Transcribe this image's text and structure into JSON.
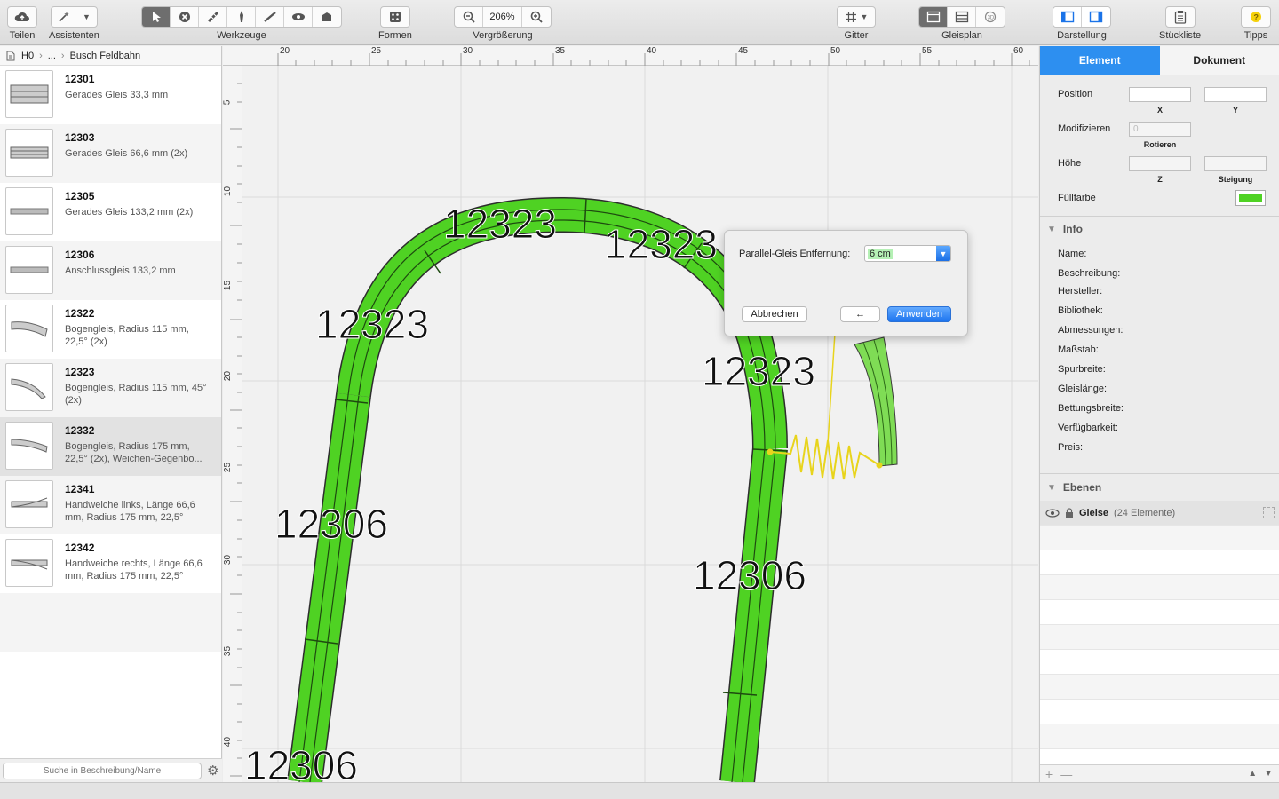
{
  "toolbar": {
    "share_label": "Teilen",
    "assistants_label": "Assistenten",
    "tools_label": "Werkzeuge",
    "shapes_label": "Formen",
    "zoom_label": "Vergrößerung",
    "zoom_value": "206%",
    "grid_label": "Gitter",
    "trackplan_label": "Gleisplan",
    "view_label": "Darstellung",
    "bom_label": "Stückliste",
    "tips_label": "Tipps"
  },
  "breadcrumb": [
    "H0",
    "...",
    "Busch Feldbahn"
  ],
  "library": {
    "items": [
      {
        "number": "12301",
        "desc": "Gerades Gleis 33,3 mm"
      },
      {
        "number": "12303",
        "desc": "Gerades Gleis 66,6 mm (2x)"
      },
      {
        "number": "12305",
        "desc": "Gerades Gleis 133,2 mm (2x)"
      },
      {
        "number": "12306",
        "desc": "Anschlussgleis 133,2 mm"
      },
      {
        "number": "12322",
        "desc": "Bogengleis, Radius 115 mm, 22,5° (2x)"
      },
      {
        "number": "12323",
        "desc": "Bogengleis, Radius 115 mm, 45° (2x)"
      },
      {
        "number": "12332",
        "desc": "Bogengleis, Radius 175 mm, 22,5° (2x), Weichen-Gegenbo..."
      },
      {
        "number": "12341",
        "desc": "Handweiche links, Länge 66,6 mm, Radius 175 mm, 22,5°"
      },
      {
        "number": "12342",
        "desc": "Handweiche rechts, Länge 66,6 mm, Radius 175 mm, 22,5°"
      }
    ],
    "search_placeholder": "Suche in Beschreibung/Name"
  },
  "rulers": {
    "h": [
      "20",
      "25",
      "30",
      "35",
      "40",
      "45",
      "50",
      "55",
      "60"
    ],
    "v": [
      "5",
      "10",
      "15",
      "20",
      "25",
      "30",
      "35",
      "40"
    ]
  },
  "plan_labels": [
    "12323",
    "12323",
    "12323",
    "12323",
    "12306",
    "12306",
    "12306"
  ],
  "track_color": "#4fd223",
  "popover": {
    "label": "Parallel-Gleis Entfernung:",
    "value": "6 cm",
    "cancel": "Abbrechen",
    "swap": "↔",
    "apply": "Anwenden"
  },
  "inspector": {
    "tabs": [
      "Element",
      "Dokument"
    ],
    "position_label": "Position",
    "x_label": "X",
    "y_label": "Y",
    "modify_label": "Modifizieren",
    "rotate_value": "0",
    "rotate_label": "Rotieren",
    "height_label": "Höhe",
    "z_label": "Z",
    "slope_label": "Steigung",
    "fill_label": "Füllfarbe",
    "fill_color": "#4fd223",
    "info_title": "Info",
    "info_fields": [
      "Name:",
      "Beschreibung:",
      "Hersteller:",
      "Bibliothek:",
      "Abmessungen:",
      "Maßstab:",
      "Spurbreite:",
      "Gleislänge:",
      "Bettungsbreite:",
      "Verfügbarkeit:",
      "Preis:"
    ],
    "layers_title": "Ebenen",
    "layer_name": "Gleise",
    "layer_count": "(24 Elemente)"
  }
}
